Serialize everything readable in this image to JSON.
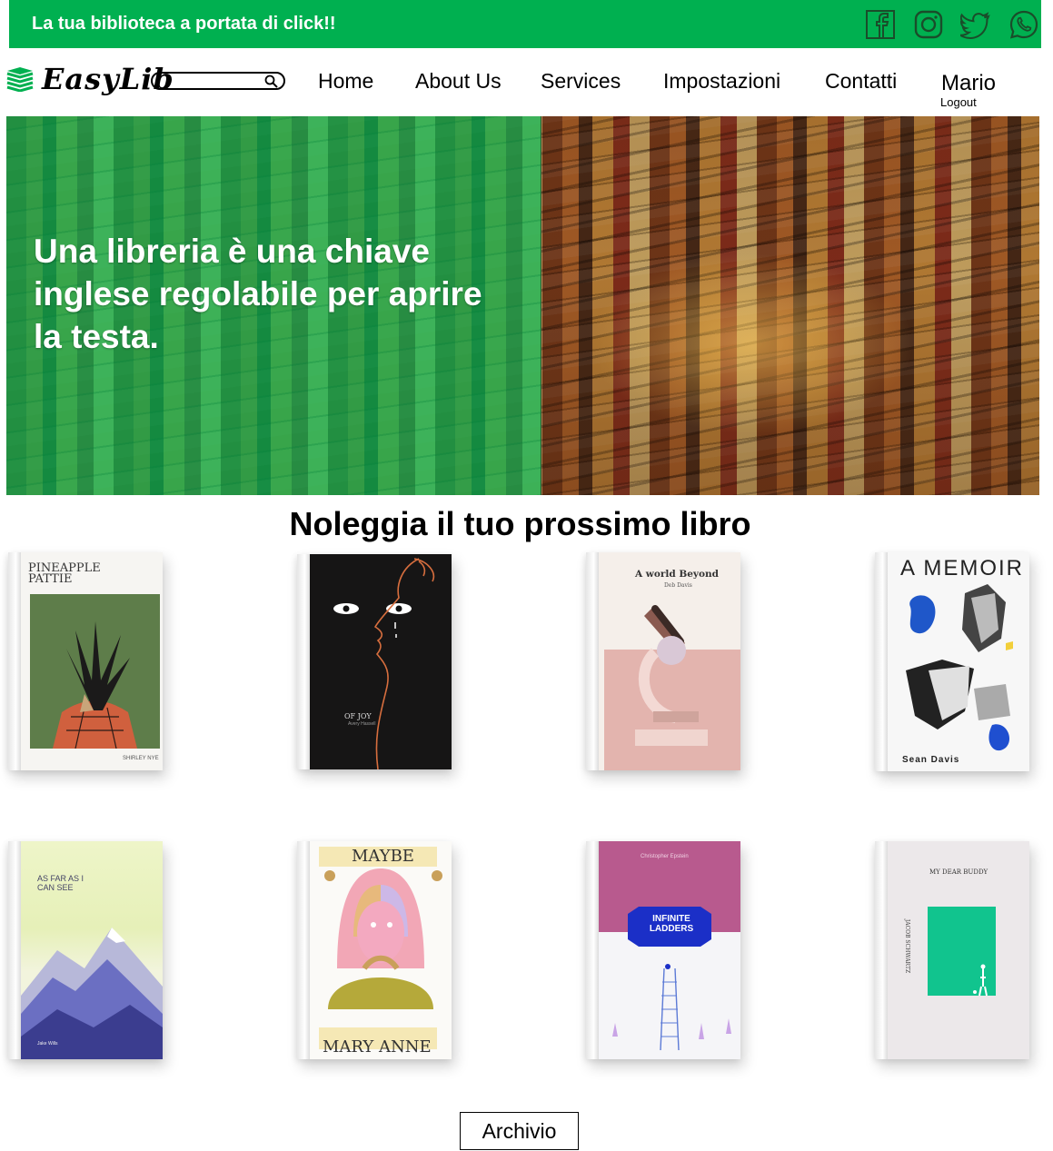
{
  "banner": {
    "tagline": "La tua biblioteca a portata di click!!",
    "social": [
      "facebook-icon",
      "instagram-icon",
      "twitter-icon",
      "whatsapp-icon"
    ]
  },
  "brand": {
    "name": "EasyLib",
    "icon": "books-icon",
    "color": "#00b050"
  },
  "search": {
    "placeholder": "",
    "icon": "search-icon"
  },
  "nav": {
    "home": "Home",
    "about": "About Us",
    "services": "Services",
    "settings": "Impostazioni",
    "contacts": "Contatti"
  },
  "user": {
    "name": "Mario",
    "logout": "Logout"
  },
  "hero": {
    "quote": "Una libreria è una chiave inglese regolabile per aprire la testa."
  },
  "section": {
    "title": "Noleggia il tuo prossimo libro"
  },
  "books": [
    {
      "title": "PINEAPPLE PATTIE",
      "author": "SHIRLEY NYE"
    },
    {
      "title": "OF JOY",
      "author": "Avery Hassell"
    },
    {
      "title": "A world Beyond",
      "author": "Deb Davis"
    },
    {
      "title": "A MEMOIR",
      "author": "Sean Davis"
    },
    {
      "title": "AS FAR AS I CAN SEE",
      "author": "Jake Wills"
    },
    {
      "title": "MAYBE",
      "author": "MARY ANNE"
    },
    {
      "title": "INFINITE LADDERS",
      "author": "Christopher Epstein"
    },
    {
      "title": "MY DEAR BUDDY",
      "author": "JACOB SCHWARTZ"
    }
  ],
  "archive_label": "Archivio"
}
